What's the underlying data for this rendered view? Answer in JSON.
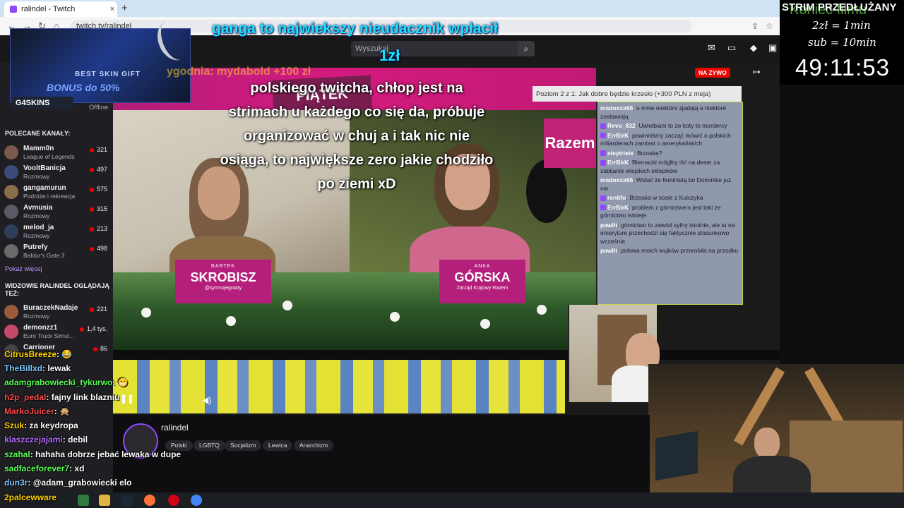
{
  "browser": {
    "tab_title": "ralindel - Twitch",
    "url": "twitch.tv/ralindel",
    "new_tab": "+",
    "close": "×"
  },
  "twitch": {
    "search_placeholder": "Wyszukaj",
    "live_badge": "NA ŻYWO",
    "poll_text": "Poziom 2 z 1: Jak dobre będzie krzesło (+300 PLN z meja)",
    "offline": "Offline",
    "show_more": "Pokaż więcej"
  },
  "sidebar": {
    "recommended_header": "POLECANE KANAŁY:",
    "recommended": [
      {
        "name": "Mamm0n",
        "game": "League of Legends",
        "viewers": "321"
      },
      {
        "name": "VooltBanicja",
        "game": "Rozmowy",
        "viewers": "497"
      },
      {
        "name": "gangamurun",
        "game": "Podróże i rekreacja",
        "viewers": "575"
      },
      {
        "name": "Avmusia",
        "game": "Rozmowy",
        "viewers": "315"
      },
      {
        "name": "melod_ja",
        "game": "Rozmowy",
        "viewers": "213"
      },
      {
        "name": "Putrefy",
        "game": "Baldur's Gate 3",
        "viewers": "498"
      }
    ],
    "also_header": "WIDZOWIE RALINDEL OGLĄDAJĄ TEŻ:",
    "also": [
      {
        "name": "BuraczekNadaje",
        "game": "Rozmowy",
        "viewers": "221"
      },
      {
        "name": "demonzz1",
        "game": "Euro Truck Simul...",
        "viewers": "1,4 tys."
      },
      {
        "name": "Carrioner",
        "game": "",
        "viewers": "86"
      }
    ]
  },
  "overlay": {
    "donation_text": "ganga to najwiekszy nieudacznik  wpłacił",
    "donation_amount": "1zł",
    "ghost_text": "ygodnia: mydabold +100 zł",
    "question": "polskiego twitcha, chłop jest na strimach u każdego co się da, próbuje organizować w chuj a i tak nic nie osiąga, to największe zero jakie chodziło po ziemi xD",
    "promo_line1": "BEST SKIN GIFT",
    "promo_line2": "BONUS  do 50%",
    "brand": "G4SKINS"
  },
  "scene": {
    "sign_text": "PIĄTEK",
    "right_sign": "Razem",
    "left_plate": {
      "small": "BARTEK",
      "name": "SKROBISZ",
      "sub": "@synmojegotaty"
    },
    "right_plate": {
      "small": "ANKA",
      "name": "GÓRSKA",
      "sub": "Zarząd Krajowy Razem"
    }
  },
  "video_chat": [
    {
      "user": "madoxxx66",
      "text": "u mnie niektóre zjadają a niektóre zostawiają"
    },
    {
      "user": "Revo_832",
      "text": "Uwielbiam to że koty to mordercy"
    },
    {
      "user": "ErrBirK",
      "text": "powinniśmy zacząć mówić o polskich miliarderach zamiast o amerykańskich"
    },
    {
      "user": "eleytriste",
      "text": "Brzoskę?"
    },
    {
      "user": "ErrBirK",
      "text": "Biernacki mógłby iść na deser za zabijanie wiejskich sklepików"
    },
    {
      "user": "madoxxx66",
      "text": "Widać że feministą bo Dominike już nie"
    },
    {
      "user": "rentifo",
      "text": "Brzoska w sosie z Kulczyka"
    },
    {
      "user": "ErrBirK",
      "text": "problem z górnictwem jest taki że górnictwo istnieje"
    },
    {
      "user": "pawlit",
      "text": "górnictwo to zawód syfny istotnie, ale tu na emeryture przechodzi się faktycznie stosunkowo wcześnie"
    },
    {
      "user": "pawlit",
      "text": "połowa moich wujków przerobiła na przodku"
    }
  ],
  "stream": {
    "channel": "ralindel",
    "tags": [
      "Polski",
      "LGBTQ",
      "Socjalizm",
      "Lewica",
      "Anarchizm"
    ]
  },
  "overlay_chat": [
    {
      "user": "CitrusBreeze",
      "text": "😂",
      "color": "#ffd400"
    },
    {
      "user": "TheBillxd",
      "text": "lewak",
      "color": "#7ec8ff"
    },
    {
      "user": "adamgrabowiecki_tykurwo",
      "text": "😁",
      "color": "#5aff5a"
    },
    {
      "user": "h2p_pedal",
      "text": "fajny link blazniu",
      "color": "#ff4b4b"
    },
    {
      "user": "MarkoJuicer",
      "text": "🙊",
      "color": "#ff4b4b"
    },
    {
      "user": "Szuk",
      "text": "za keydropa",
      "color": "#ffd400"
    },
    {
      "user": "klaszczejajami",
      "text": "debil",
      "color": "#b36bff"
    },
    {
      "user": "szahal",
      "text": "hahaha dobrze jebać lewaka w dupe",
      "color": "#5aff5a"
    },
    {
      "user": "sadfaceforever7",
      "text": "xd",
      "color": "#5aff5a"
    },
    {
      "user": "dun3r",
      "text": "@adam_grabowiecki elo",
      "color": "#7ec8ff"
    },
    {
      "user": "2palcewware",
      "text": "",
      "color": "#ffd400"
    }
  ],
  "right_panel": {
    "title": "STRIM PRZEDŁUŻANY",
    "watermark": "Koniec filmu",
    "rate1": "2zł = 1min",
    "rate2": "sub = 10min",
    "timer": "49:11:53"
  },
  "colors": {
    "twitch_purple": "#9146ff",
    "live_red": "#eb0400",
    "donation_cyan": "#19e3ff"
  }
}
